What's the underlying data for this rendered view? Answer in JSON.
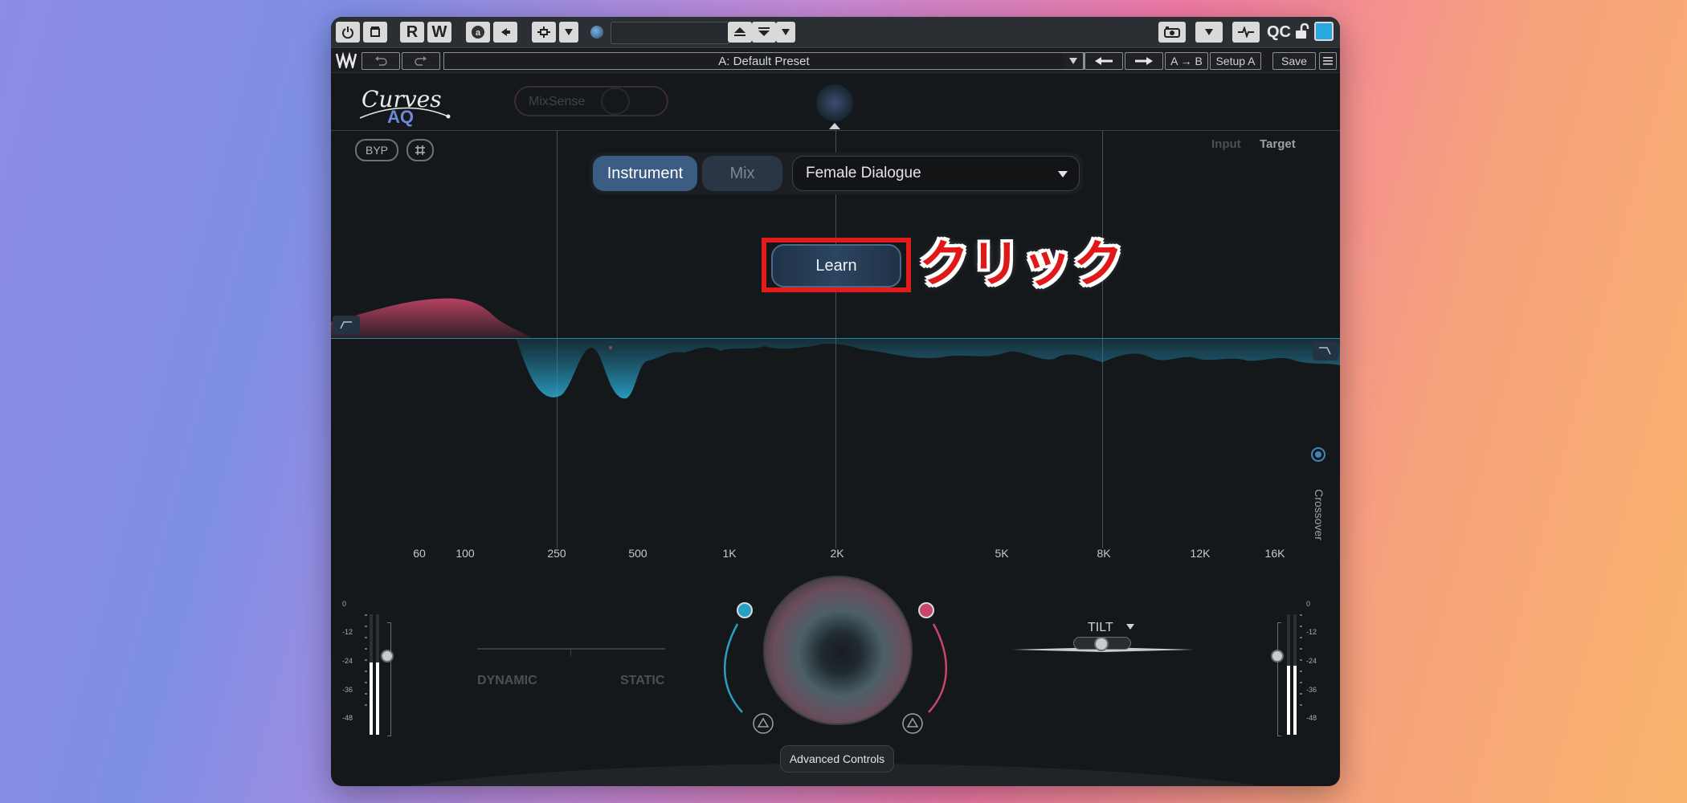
{
  "host_toolbar": {
    "r_label": "R",
    "w_label": "W",
    "qc_label": "QC",
    "colors": {
      "power": "#d9d9d9",
      "swatch": "#2aa7e0"
    }
  },
  "preset_bar": {
    "preset_name": "A: Default Preset",
    "ab_label": "A → B",
    "setup_label": "Setup A",
    "save_label": "Save"
  },
  "plugin": {
    "logo_top": "Curves",
    "logo_bottom": "AQ",
    "mixsense_label": "MixSense",
    "byp_label": "BYP",
    "input_label": "Input",
    "target_label": "Target",
    "mode_instrument": "Instrument",
    "mode_mix": "Mix",
    "selected_mode": "Instrument",
    "category_value": "Female Dialogue",
    "learn_label": "Learn",
    "crossover_label": "Crossover",
    "freq_labels": [
      "60",
      "100",
      "250",
      "500",
      "1K",
      "2K",
      "5K",
      "8K",
      "12K",
      "16K"
    ],
    "meter_scale": [
      "0",
      "-12",
      "-24",
      "-36",
      "-48"
    ],
    "dynamic_label": "DYNAMIC",
    "static_label": "STATIC",
    "tilt_label": "TILT",
    "advanced_label": "Advanced Controls",
    "colors": {
      "accent_blue": "#2a9fc4",
      "accent_red": "#c8466a",
      "selected": "#3c5d82"
    }
  },
  "annotation": {
    "text": "クリック",
    "color": "#e01818"
  }
}
